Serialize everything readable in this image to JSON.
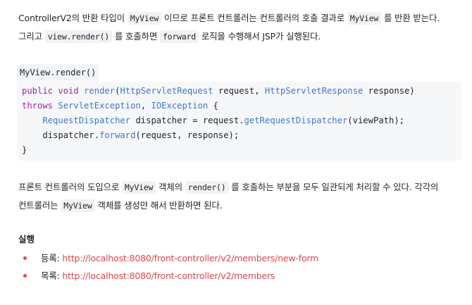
{
  "paragraph1": {
    "line1_a": "ControllerV2의 반환 타입이 ",
    "code_myview_1": "MyView",
    "line1_b": " 이므로 프론트 컨트롤러는 컨트롤러의 호출 결과로 ",
    "code_myview_2": "MyView",
    "line1_c": " 를 반환 받는다.",
    "line2_a": "그리고 ",
    "code_render": "view.render()",
    "line2_b": " 를 호출하면 ",
    "code_forward": "forward",
    "line2_c": " 로직을 수행해서 JSP가 실행된다."
  },
  "code_title": "MyView.render()",
  "code": {
    "l1_kw1": "public",
    "l1_kw2": "void",
    "l1_fn": "render",
    "l1_p1": "(",
    "l1_t1": "HttpServletRequest",
    "l1_v1": " request, ",
    "l1_t2": "HttpServletResponse",
    "l1_v2": " response)",
    "l2_kw": "throws",
    "l2_t1": "ServletException",
    "l2_c": ", ",
    "l2_t2": "IOException",
    "l2_b": " {",
    "l3_t": "RequestDispatcher",
    "l3_a": " dispatcher = request.",
    "l3_m": "getRequestDispatcher",
    "l3_b": "(viewPath);",
    "l4_a": "dispatcher.",
    "l4_m": "forward",
    "l4_b": "(request, response);",
    "l5": "}"
  },
  "paragraph2": {
    "line1_a": "프론트 컨트롤러의 도입으로 ",
    "code_myview": "MyView",
    "line1_b": " 객체의 ",
    "code_render": "render()",
    "line1_c": " 를 호출하는 부분을 모두 일관되게 처리할 수 있다. 각각의",
    "line2_a": "컨트롤러는 ",
    "code_myview_2": "MyView",
    "line2_b": " 객체를 생성만 해서 반환하면 된다."
  },
  "run_section": {
    "title": "실행",
    "items": [
      {
        "label": "등록: ",
        "url": "http://localhost:8080/front-controller/v2/members/new-form"
      },
      {
        "label": "목록: ",
        "url": "http://localhost:8080/front-controller/v2/members"
      }
    ]
  },
  "colors": {
    "link": "#d9464c",
    "bullet": "#e0484c",
    "keyword": "#a626a4",
    "type": "#4078c0"
  }
}
